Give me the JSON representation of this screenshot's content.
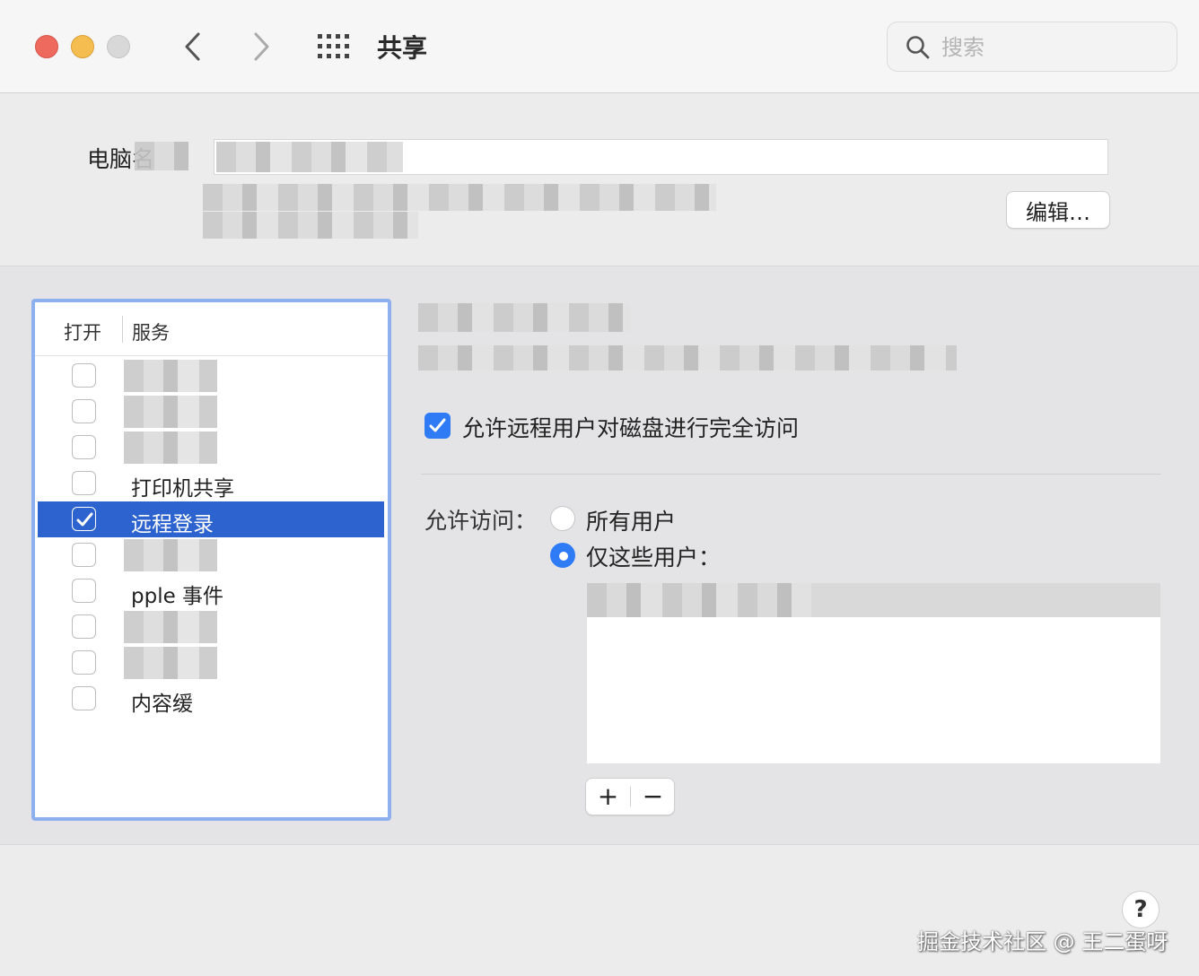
{
  "window": {
    "title": "共享",
    "search_placeholder": "搜索"
  },
  "computer_name": {
    "label": "电脑名",
    "value": "",
    "edit_label": "编辑…"
  },
  "services": {
    "header_on": "打开",
    "header_service": "服务",
    "items": [
      {
        "label": "",
        "checked": false,
        "selected": false,
        "redacted": true
      },
      {
        "label": "",
        "checked": false,
        "selected": false,
        "redacted": true
      },
      {
        "label": "",
        "checked": false,
        "selected": false,
        "redacted": true
      },
      {
        "label": "打印机共享",
        "checked": false,
        "selected": false,
        "redacted": false
      },
      {
        "label": "远程登录",
        "checked": true,
        "selected": true,
        "redacted": false
      },
      {
        "label": "",
        "checked": false,
        "selected": false,
        "redacted": true
      },
      {
        "label": "pple 事件",
        "checked": false,
        "selected": false,
        "redacted": false
      },
      {
        "label": "",
        "checked": false,
        "selected": false,
        "redacted": true
      },
      {
        "label": "",
        "checked": false,
        "selected": false,
        "redacted": true
      },
      {
        "label": "内容缓",
        "checked": false,
        "selected": false,
        "redacted": false
      }
    ]
  },
  "detail": {
    "full_disk_access_label": "允许远程用户对磁盘进行完全访问",
    "full_disk_access_checked": true,
    "allow_access_label": "允许访问：",
    "radio_all_users": "所有用户",
    "radio_only_users": "仅这些用户：",
    "selected_radio": "only",
    "add_label": "+",
    "remove_label": "−"
  },
  "help_label": "?",
  "watermark": "掘金技术社区 @ 王二蛋呀",
  "colors": {
    "selection": "#2c63cf",
    "checkbox_accent": "#2f7bf6",
    "close": "#ee6a5e",
    "minimize": "#f5bd4f",
    "zoom_disabled": "#d8d8d8"
  }
}
